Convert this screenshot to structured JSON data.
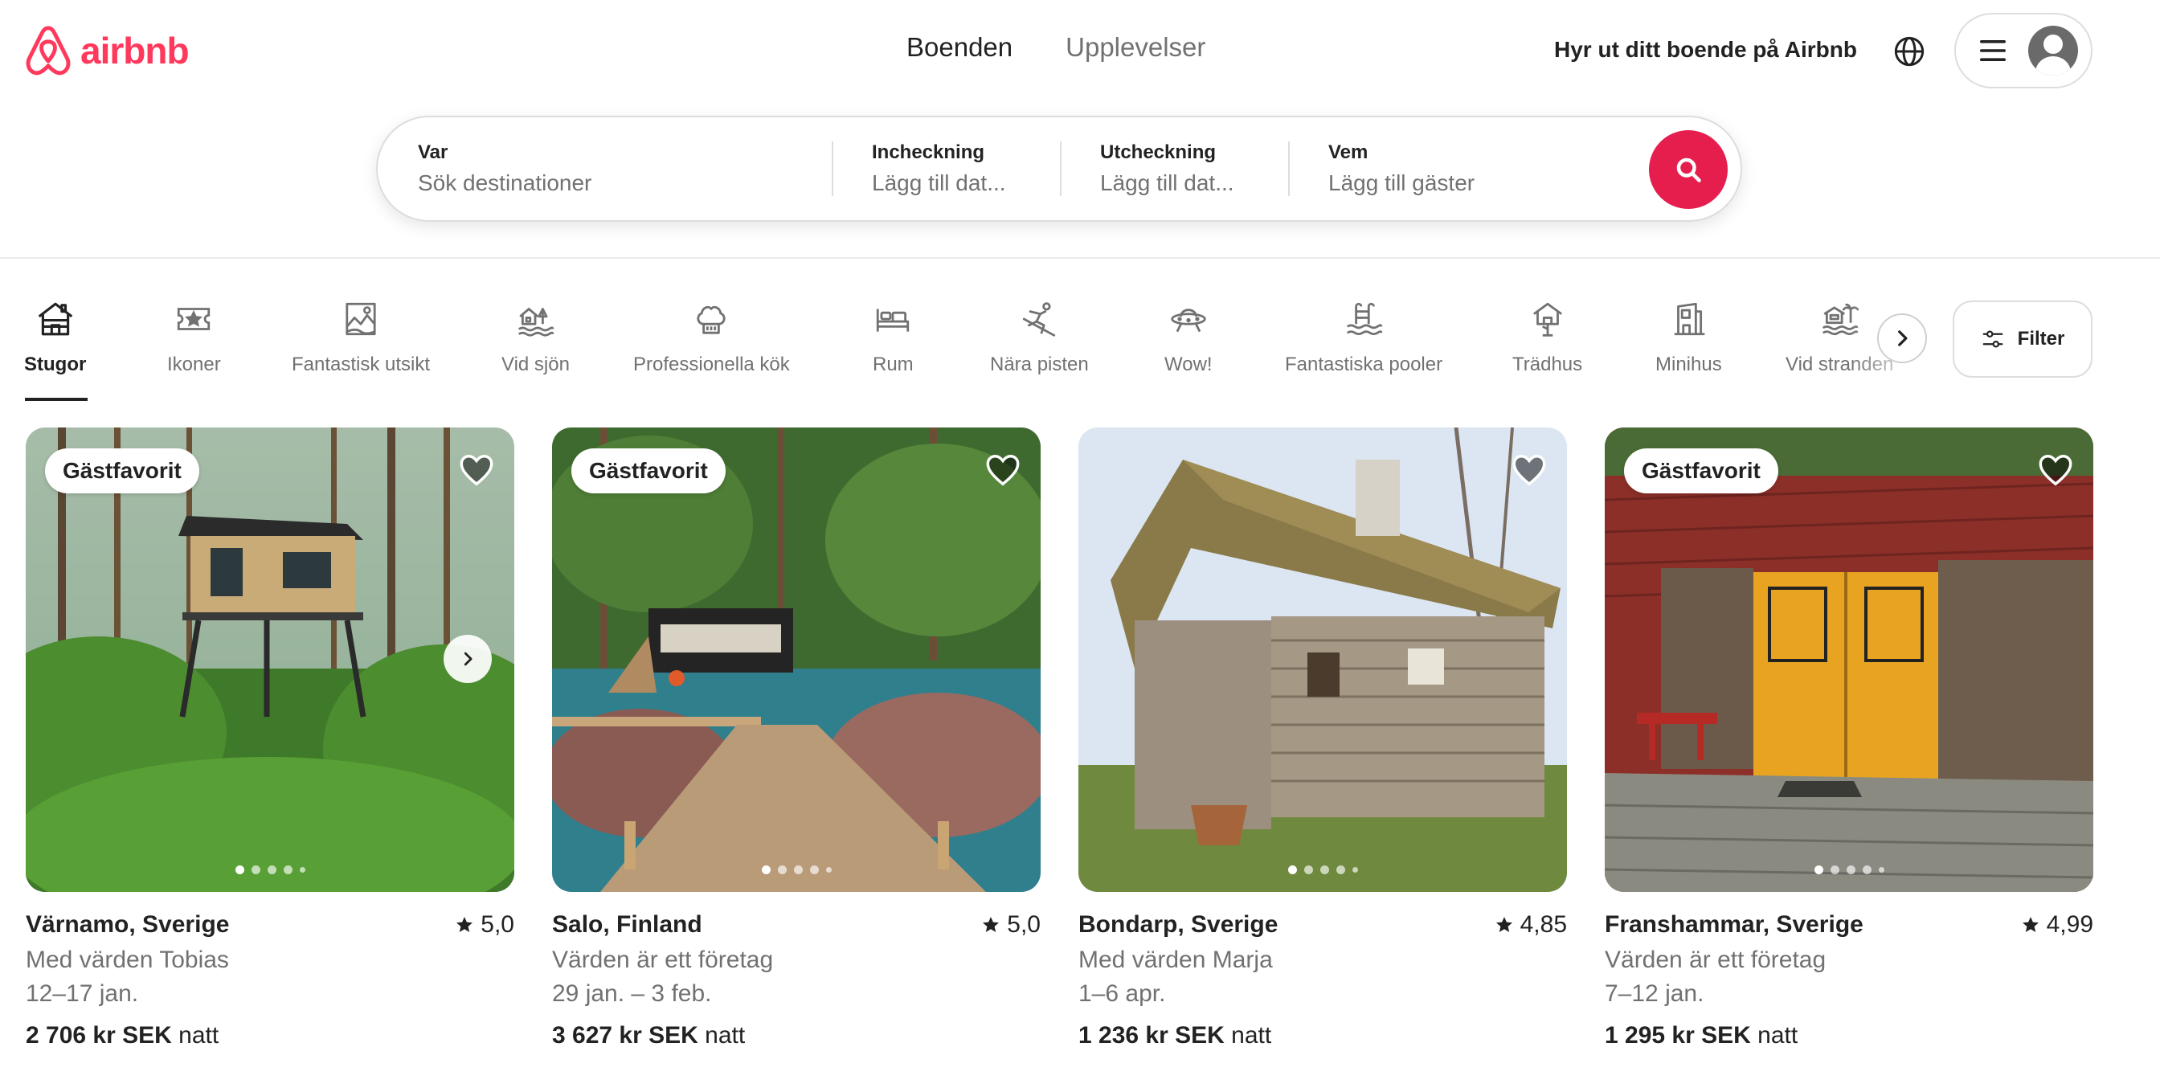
{
  "brand": {
    "name": "airbnb",
    "color": "#FF385C"
  },
  "nav": {
    "tabs": [
      {
        "label": "Boenden",
        "active": true
      },
      {
        "label": "Upplevelser",
        "active": false
      }
    ]
  },
  "header": {
    "host_link": "Hyr ut ditt boende på Airbnb",
    "icons": [
      "globe-icon",
      "menu-icon",
      "avatar"
    ]
  },
  "search": {
    "where": {
      "label": "Var",
      "placeholder": "Sök destinationer"
    },
    "checkin": {
      "label": "Incheckning",
      "placeholder": "Lägg till dat..."
    },
    "checkout": {
      "label": "Utcheckning",
      "placeholder": "Lägg till dat..."
    },
    "who": {
      "label": "Vem",
      "placeholder": "Lägg till gäster"
    },
    "button_icon": "search-icon",
    "button_color": "#E61E4D"
  },
  "categories": [
    {
      "label": "Stugor",
      "icon": "cabin-icon",
      "active": true
    },
    {
      "label": "Ikoner",
      "icon": "ticket-icon"
    },
    {
      "label": "Fantastisk utsikt",
      "icon": "view-icon"
    },
    {
      "label": "Vid sjön",
      "icon": "lake-icon"
    },
    {
      "label": "Professionella kök",
      "icon": "chef-hat-icon"
    },
    {
      "label": "Rum",
      "icon": "bed-icon"
    },
    {
      "label": "Nära pisten",
      "icon": "skier-icon"
    },
    {
      "label": "Wow!",
      "icon": "ufo-icon"
    },
    {
      "label": "Fantastiska pooler",
      "icon": "pool-icon"
    },
    {
      "label": "Trädhus",
      "icon": "treehouse-icon"
    },
    {
      "label": "Minihus",
      "icon": "tiny-house-icon"
    },
    {
      "label": "Vid stranden",
      "icon": "beach-icon"
    }
  ],
  "filter": {
    "label": "Filter",
    "icon": "sliders-icon"
  },
  "listings": [
    {
      "badge": "Gästfavorit",
      "location": "Värnamo, Sverige",
      "rating": "5,0",
      "host": "Med värden Tobias",
      "dates": "12–17 jan.",
      "price": "2 706 kr SEK",
      "price_unit": "natt"
    },
    {
      "badge": "Gästfavorit",
      "location": "Salo, Finland",
      "rating": "5,0",
      "host": "Värden är ett företag",
      "dates": "29 jan. – 3 feb.",
      "price": "3 627 kr SEK",
      "price_unit": "natt"
    },
    {
      "badge": "",
      "location": "Bondarp, Sverige",
      "rating": "4,85",
      "host": "Med värden Marja",
      "dates": "1–6 apr.",
      "price": "1 236 kr SEK",
      "price_unit": "natt"
    },
    {
      "badge": "Gästfavorit",
      "location": "Franshammar, Sverige",
      "rating": "4,99",
      "host": "Värden är ett företag",
      "dates": "7–12 jan.",
      "price": "1 295 kr SEK",
      "price_unit": "natt"
    }
  ]
}
